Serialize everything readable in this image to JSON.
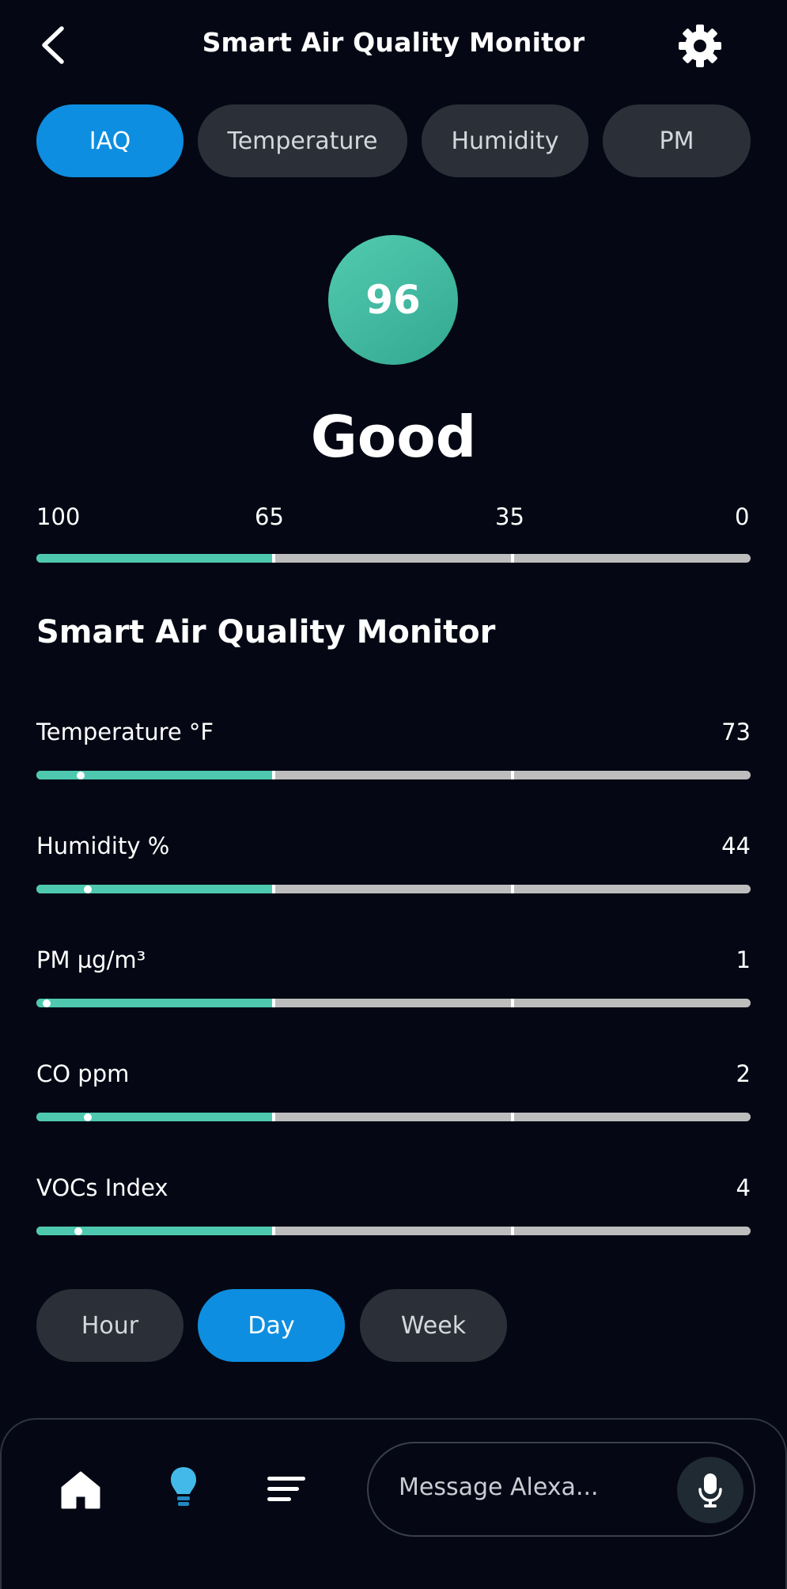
{
  "header": {
    "title": "Smart Air Quality Monitor",
    "back_icon": "chevron-left-icon",
    "settings_icon": "gear-icon"
  },
  "tabs": [
    {
      "label": "IAQ",
      "active": true
    },
    {
      "label": "Temperature",
      "active": false
    },
    {
      "label": "Humidity",
      "active": false
    },
    {
      "label": "PM",
      "active": false
    }
  ],
  "score": {
    "value": "96",
    "status": "Good",
    "color": "#45bfa5"
  },
  "scale": {
    "ticks": [
      "100",
      "65",
      "35",
      "0"
    ]
  },
  "section_title": "Smart Air Quality Monitor",
  "metrics": [
    {
      "name": "Temperature °F",
      "value": "73"
    },
    {
      "name": "Humidity %",
      "value": "44"
    },
    {
      "name": "PM µg/m³",
      "value": "1"
    },
    {
      "name": "CO ppm",
      "value": "2"
    },
    {
      "name": "VOCs Index",
      "value": "4"
    }
  ],
  "ranges": [
    {
      "label": "Hour",
      "active": false
    },
    {
      "label": "Day",
      "active": true
    },
    {
      "label": "Week",
      "active": false
    }
  ],
  "bottom_nav": {
    "items": [
      {
        "icon": "home-icon",
        "active": false
      },
      {
        "icon": "lightbulb-icon",
        "active": true
      },
      {
        "icon": "menu-icon",
        "active": false
      }
    ],
    "message_placeholder": "Message Alexa...",
    "mic_icon": "microphone-icon"
  },
  "colors": {
    "background": "#050814",
    "accent_blue": "#0e8ee0",
    "good_green": "#4ec9af",
    "pill_gray": "#2b3038",
    "track_gray": "#bdbdbd"
  }
}
